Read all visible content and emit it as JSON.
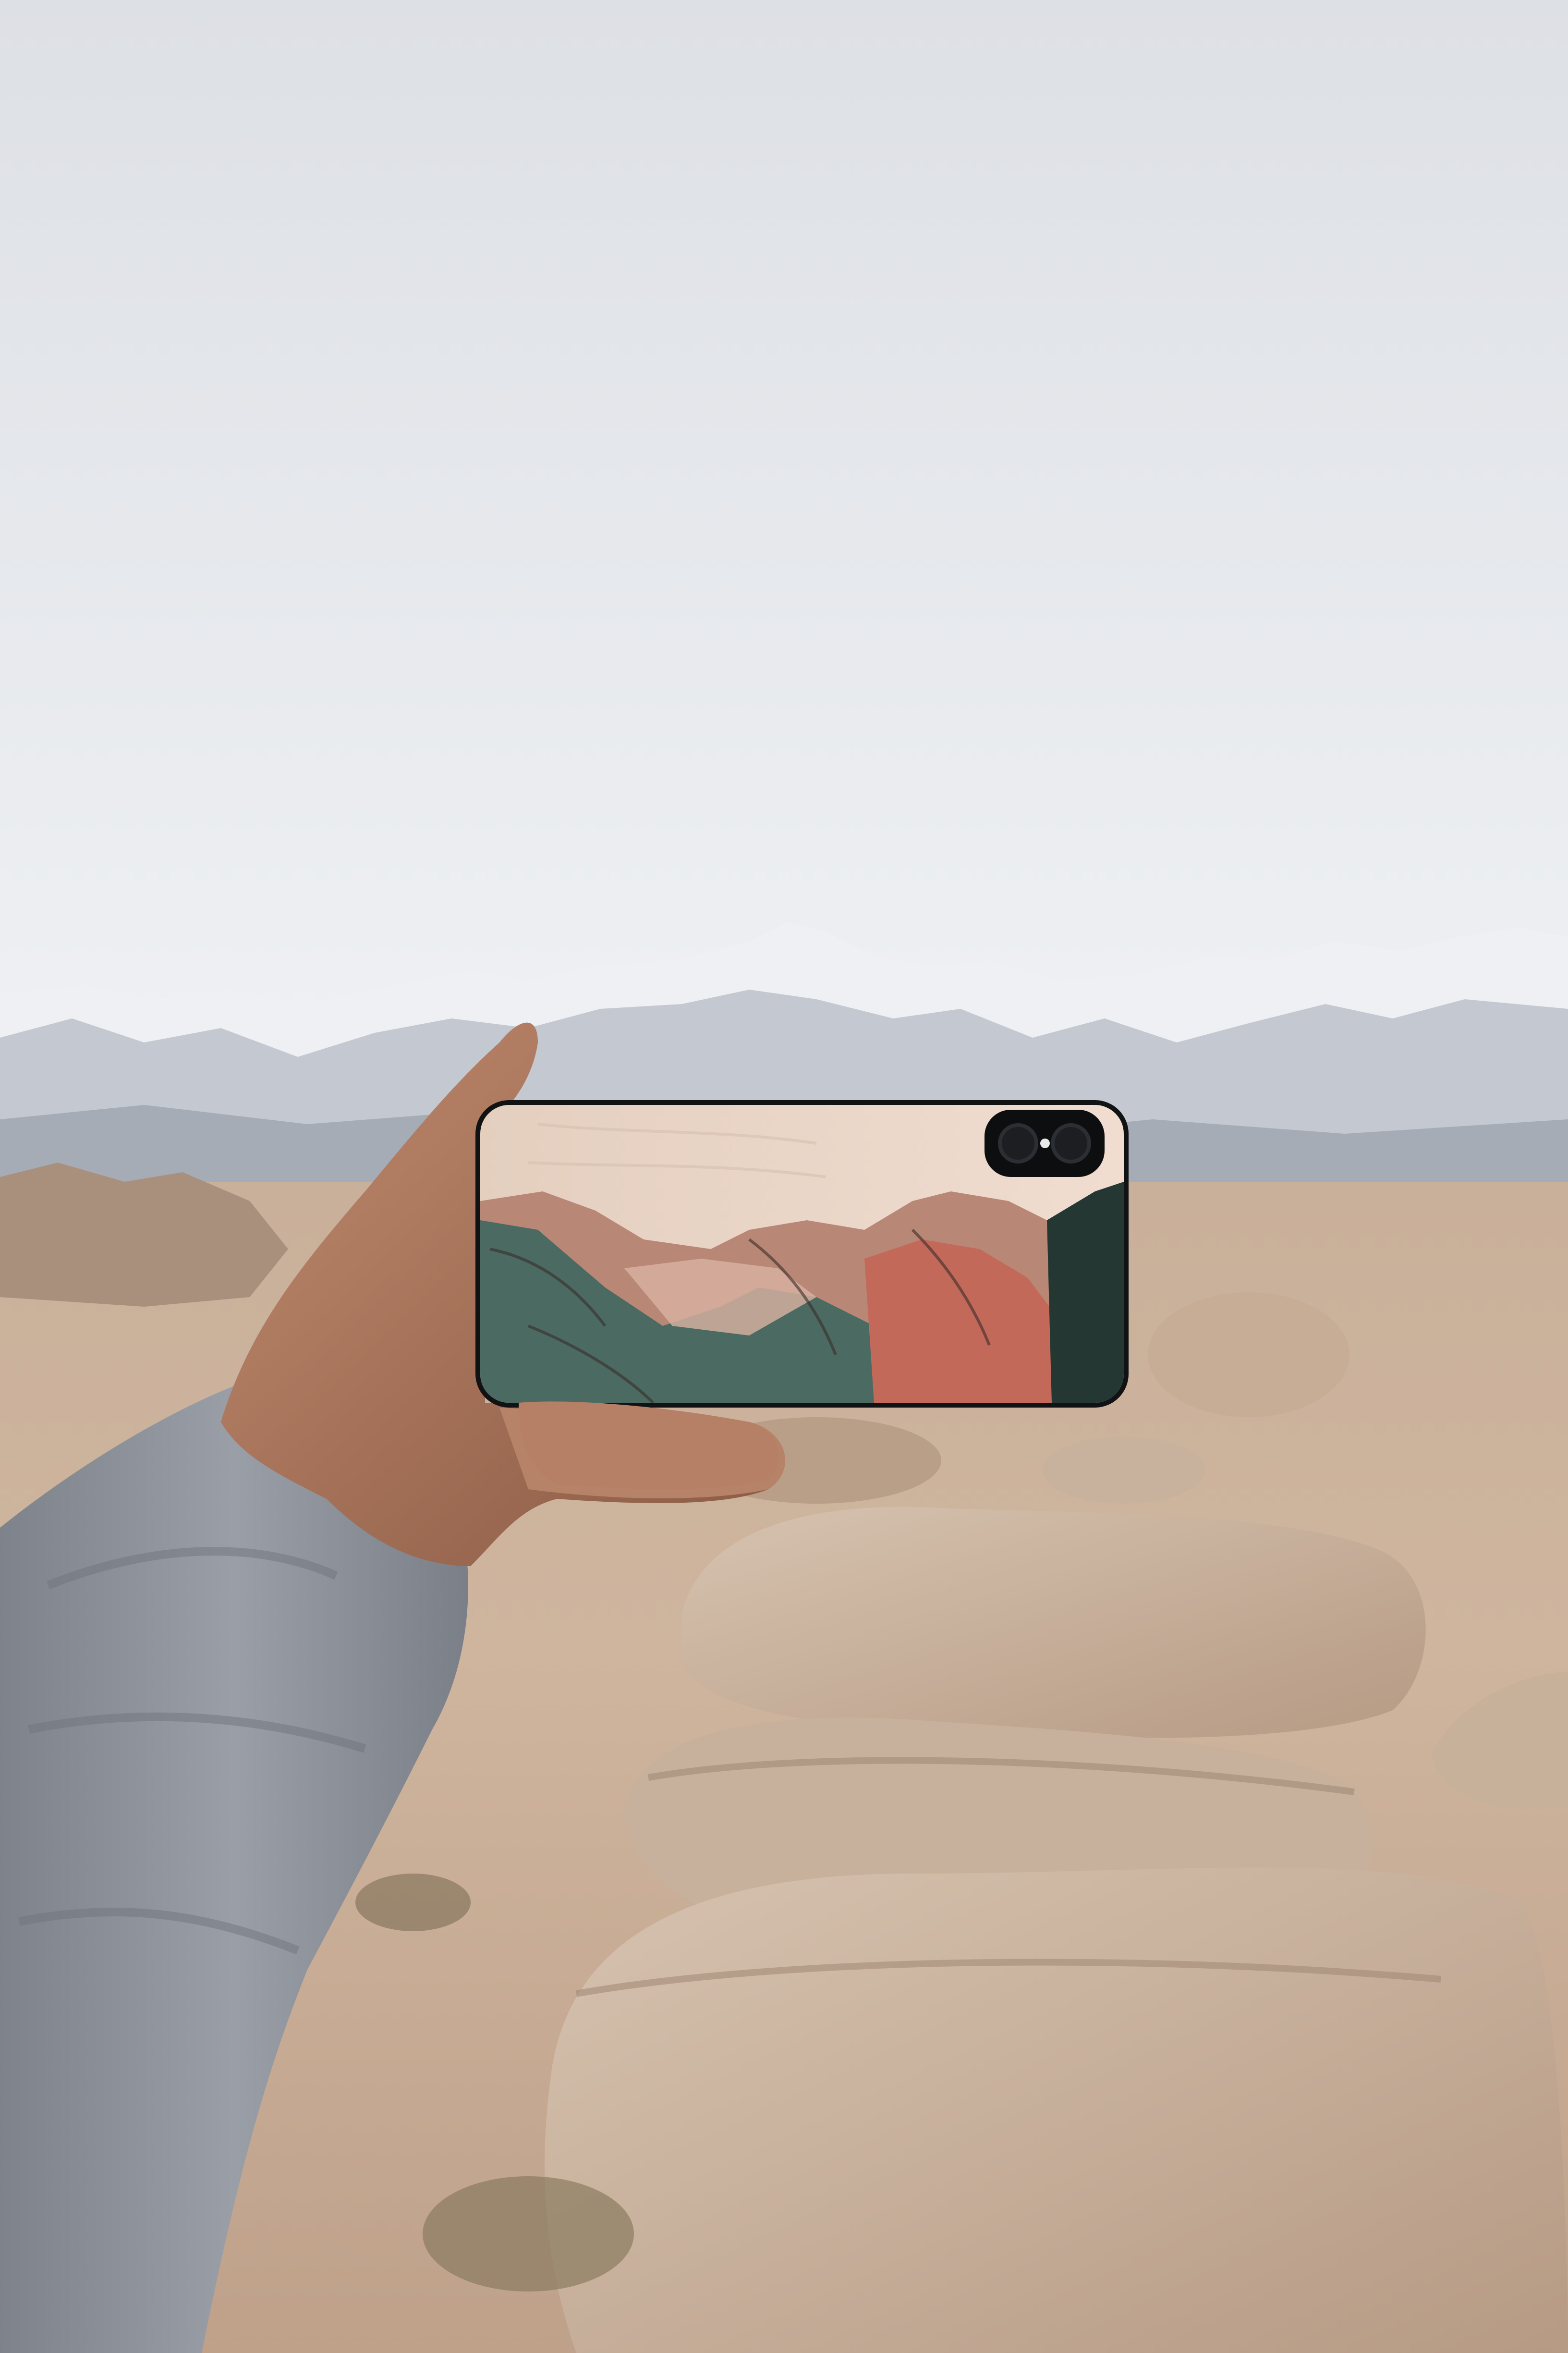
{
  "scene": {
    "type": "photograph",
    "subjects": [
      "sky",
      "snowy-mountain-range",
      "desert-boulders",
      "hand",
      "sleeve",
      "phone",
      "phone-case-artwork",
      "camera-module"
    ]
  },
  "palette": {
    "sky_top": "#dfe1e6",
    "sky_bottom": "#eceef2",
    "snow": "#f3f4f6",
    "mountain_shadow": "#9aa0aa",
    "desert": "#c7ad92",
    "boulder": "#c9b39e",
    "boulder_shadow": "#9f8672",
    "skin": "#b07a5f",
    "skin_shadow": "#8a5a44",
    "sleeve": "#8f949c",
    "sleeve_dark": "#6f747c",
    "phone_frame": "#111214",
    "case_wood": "#ead7c7",
    "art_rose": "#b98776",
    "art_rust": "#c3695a",
    "art_green": "#4a6a62",
    "art_dark": "#243732"
  }
}
